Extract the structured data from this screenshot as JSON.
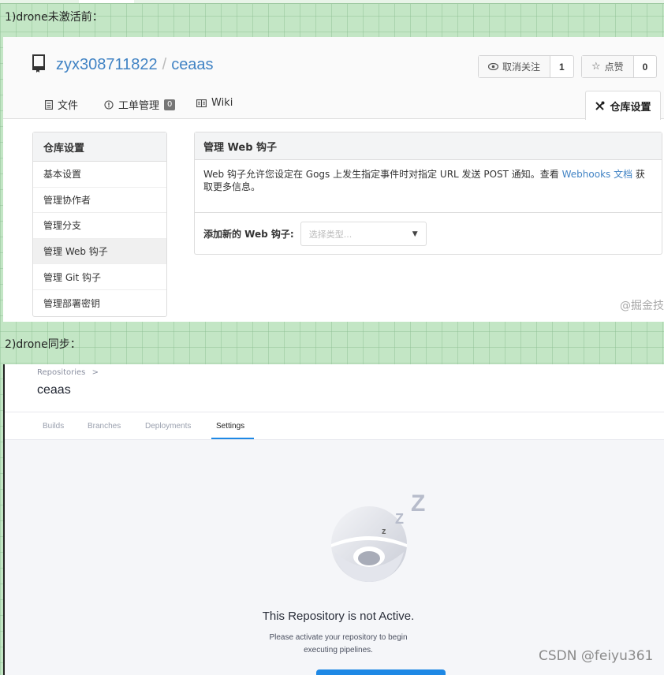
{
  "captions": {
    "first": "1)drone未激活前：",
    "second": "2)drone同步："
  },
  "gogs": {
    "repo": {
      "owner": "zyx308711822",
      "separator": "/",
      "name": "ceaas"
    },
    "watch": {
      "label": "取消关注",
      "count": "1",
      "icon": "eye-icon"
    },
    "star": {
      "label": "点赞",
      "count": "0",
      "icon": "star-icon"
    },
    "tabs": {
      "files": "文件",
      "issues": "工单管理",
      "issues_count": "0",
      "wiki": "Wiki",
      "settings": "仓库设置"
    },
    "sidebar": {
      "title": "仓库设置",
      "items": [
        {
          "label": "基本设置"
        },
        {
          "label": "管理协作者"
        },
        {
          "label": "管理分支"
        },
        {
          "label": "管理 Web 钩子"
        },
        {
          "label": "管理 Git 钩子"
        },
        {
          "label": "管理部署密钥"
        }
      ],
      "active_index": 3
    },
    "webhooks": {
      "title": "管理 Web 钩子",
      "desc_before": "Web 钩子允许您设定在 Gogs 上发生指定事件时对指定 URL 发送 POST 通知。查看 ",
      "desc_link": "Webhooks 文档",
      "desc_after": " 获取更多信息。",
      "add_label": "添加新的 Web 钩子:",
      "select_placeholder": "选择类型..."
    },
    "watermark": "@掘金技"
  },
  "drone": {
    "breadcrumb": "Repositories",
    "breadcrumb_chevron": ">",
    "repo_name": "ceaas",
    "tabs": [
      "Builds",
      "Branches",
      "Deployments",
      "Settings"
    ],
    "active_tab": "Settings",
    "empty_state": {
      "title": "This Repository is not Active.",
      "line1": "Please activate your repository to begin",
      "line2": "executing pipelines."
    },
    "sleep_letters": [
      "Z",
      "Z",
      "z"
    ]
  },
  "watermark": "CSDN @feiyu361",
  "colors": {
    "link": "#4183c4",
    "drone_accent": "#1e88e5",
    "background": "#c3e6c5"
  }
}
